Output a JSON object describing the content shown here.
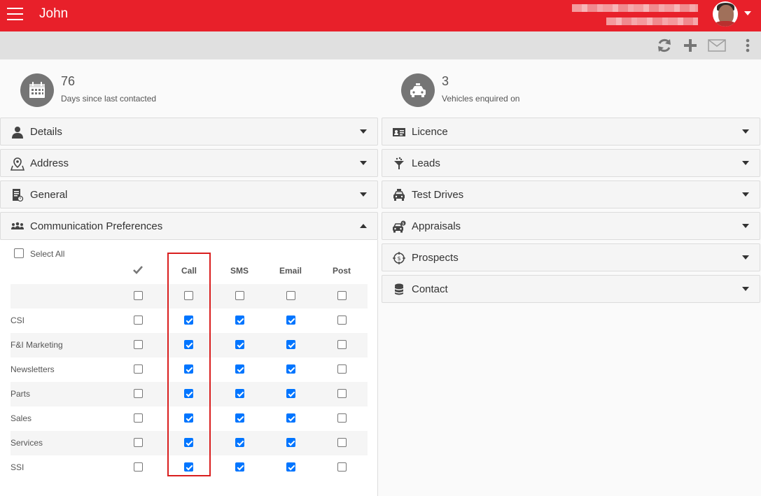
{
  "header": {
    "title": "John",
    "menu_icon": "hamburger-menu-icon",
    "avatar_icon": "user-avatar"
  },
  "toolbar": {
    "refresh_icon": "refresh-icon",
    "add_icon": "plus-icon",
    "mail_icon": "envelope-icon",
    "more_icon": "more-vertical-icon"
  },
  "stats": [
    {
      "value": "76",
      "label": "Days since last contacted",
      "icon": "calendar-icon"
    },
    {
      "value": "3",
      "label": "Vehicles enquired on",
      "icon": "car-icon"
    }
  ],
  "left_panels": [
    {
      "label": "Details",
      "icon": "user-icon",
      "expanded": false
    },
    {
      "label": "Address",
      "icon": "map-pin-icon",
      "expanded": false
    },
    {
      "label": "General",
      "icon": "document-icon",
      "expanded": false
    },
    {
      "label": "Communication Preferences",
      "icon": "people-icon",
      "expanded": true
    }
  ],
  "right_panels": [
    {
      "label": "Licence",
      "icon": "id-card-icon"
    },
    {
      "label": "Leads",
      "icon": "funnel-icon"
    },
    {
      "label": "Test Drives",
      "icon": "car-front-icon"
    },
    {
      "label": "Appraisals",
      "icon": "car-value-icon"
    },
    {
      "label": "Prospects",
      "icon": "target-icon"
    },
    {
      "label": "Contact",
      "icon": "database-icon"
    }
  ],
  "comm_prefs": {
    "select_all_label": "Select All",
    "select_all_checked": false,
    "columns": [
      "Call",
      "SMS",
      "Email",
      "Post"
    ],
    "all_column_icon": "checkmark-icon",
    "header_row": {
      "all": false,
      "values": [
        false,
        false,
        false,
        false
      ]
    },
    "rows": [
      {
        "label": "CSI",
        "all": false,
        "values": [
          true,
          true,
          true,
          false
        ]
      },
      {
        "label": "F&I Marketing",
        "all": false,
        "values": [
          true,
          true,
          true,
          false
        ]
      },
      {
        "label": "Newsletters",
        "all": false,
        "values": [
          true,
          true,
          true,
          false
        ]
      },
      {
        "label": "Parts",
        "all": false,
        "values": [
          true,
          true,
          true,
          false
        ]
      },
      {
        "label": "Sales",
        "all": false,
        "values": [
          true,
          true,
          true,
          false
        ]
      },
      {
        "label": "Services",
        "all": false,
        "values": [
          true,
          true,
          true,
          false
        ]
      },
      {
        "label": "SSI",
        "all": false,
        "values": [
          true,
          true,
          true,
          false
        ]
      }
    ],
    "highlighted_column": "Call",
    "highlight_color": "#d91e1e"
  },
  "colors": {
    "brand": "#e8202a",
    "toolbar": "#e0e0e0",
    "checkbox_on": "#0075ff"
  }
}
